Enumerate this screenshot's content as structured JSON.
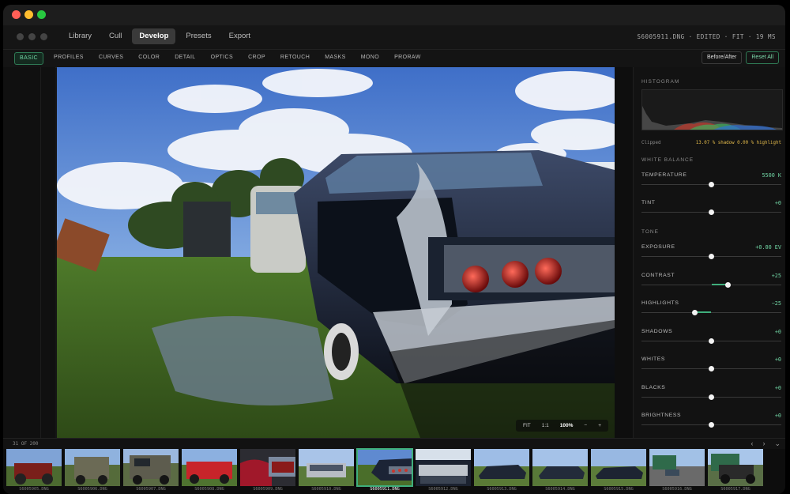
{
  "window": {
    "traffic_lights": [
      "close",
      "minimize",
      "zoom"
    ]
  },
  "header": {
    "modes": [
      "Library",
      "Cull",
      "Develop",
      "Presets",
      "Export"
    ],
    "active_mode": "Develop",
    "file_info": "S6005911.DNG · EDITED · FIT · 19 MS"
  },
  "toolbar": {
    "tools": [
      "BASIC",
      "PROFILES",
      "CURVES",
      "COLOR",
      "DETAIL",
      "OPTICS",
      "CROP",
      "RETOUCH",
      "MASKS",
      "MONO",
      "PRORAW"
    ],
    "active_tool": "BASIC",
    "before_after_label": "Before/After",
    "reset_label": "Reset All"
  },
  "viewer": {
    "zoom_controls": [
      "FIT",
      "1:1",
      "100%",
      "−",
      "+"
    ],
    "active_zoom": "100%"
  },
  "panel": {
    "histogram_title": "HISTOGRAM",
    "clipped_label": "Clipped",
    "clipped_values": "13.07 % shadow  0.00 % highlight",
    "white_balance_title": "WHITE BALANCE",
    "tone_title": "TONE",
    "sliders": [
      {
        "key": "temperature",
        "label": "TEMPERATURE",
        "value": "5500 K",
        "level": 0.5,
        "center": null
      },
      {
        "key": "tint",
        "label": "TINT",
        "value": "+0",
        "level": 0.5,
        "center": 0.5
      },
      {
        "key": "exposure",
        "label": "EXPOSURE",
        "value": "+0.00 EV",
        "level": 0.5,
        "center": 0.5
      },
      {
        "key": "contrast",
        "label": "CONTRAST",
        "value": "+25",
        "level": 0.62,
        "center": 0.5
      },
      {
        "key": "highlights",
        "label": "HIGHLIGHTS",
        "value": "−25",
        "level": 0.38,
        "center": 0.5
      },
      {
        "key": "shadows",
        "label": "SHADOWS",
        "value": "+0",
        "level": 0.5,
        "center": 0.5
      },
      {
        "key": "whites",
        "label": "WHITES",
        "value": "+0",
        "level": 0.5,
        "center": 0.5
      },
      {
        "key": "blacks",
        "label": "BLACKS",
        "value": "+0",
        "level": 0.5,
        "center": 0.5
      },
      {
        "key": "brightness",
        "label": "BRIGHTNESS",
        "value": "+0",
        "level": 0.5,
        "center": 0.5
      }
    ]
  },
  "filmstrip": {
    "count": "31 OF 200",
    "nav": [
      "‹",
      "›",
      "⌄"
    ],
    "selected": "S6005911.DNG",
    "thumbs": [
      "S6005905.DNG",
      "S6005906.DNG",
      "S6005907.DNG",
      "S6005908.DNG",
      "S6005909.DNG",
      "S6005910.DNG",
      "S6005911.DNG",
      "S6005912.DNG",
      "S6005913.DNG",
      "S6005914.DNG",
      "S6005915.DNG",
      "S6005916.DNG",
      "S6005917.DNG"
    ]
  }
}
